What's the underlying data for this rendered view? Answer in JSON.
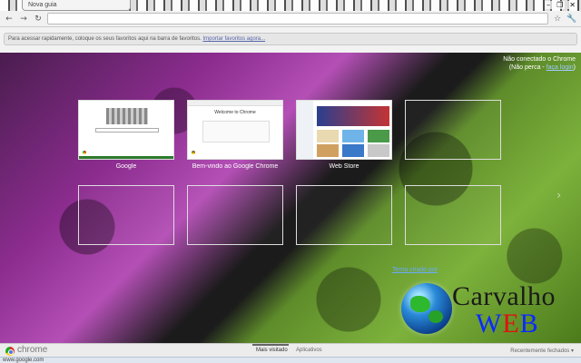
{
  "tab": {
    "title": "Nova guia"
  },
  "window": {
    "minimize": "–",
    "restore": "❐",
    "close": "✕"
  },
  "toolbar": {
    "back": "←",
    "forward": "→",
    "reload": "↻",
    "star": "☆",
    "wrench": "🔧"
  },
  "bookmarks": {
    "hint": "Para acessar rapidamente, coloque os seus favoritos aqui na barra de favoritos. ",
    "import_link": "Importar favoritos agora..."
  },
  "login": {
    "line1": "Não conectado o Chrome",
    "line2_prefix": "(Não perca - ",
    "line2_link": "faça login",
    "line2_suffix": ")"
  },
  "thumbs": [
    {
      "title": "Google"
    },
    {
      "title": "Bem-vindo ao Google Chrome",
      "inner": "Welcome to Chrome"
    },
    {
      "title": "Web Store"
    }
  ],
  "theme_link": "Tema criado por",
  "brand": {
    "word": "Carvalho",
    "web": [
      "W",
      "E",
      "B"
    ]
  },
  "footer": {
    "product": "chrome",
    "most_visited": "Mais visitado",
    "apps": "Aplicativos",
    "recent": "Recentemente fechados ▾"
  },
  "status_url": "www.google.com",
  "colors": {
    "accent": "#5566aa",
    "theme_purple": "#8b2c8e",
    "theme_green": "#7db23c"
  }
}
